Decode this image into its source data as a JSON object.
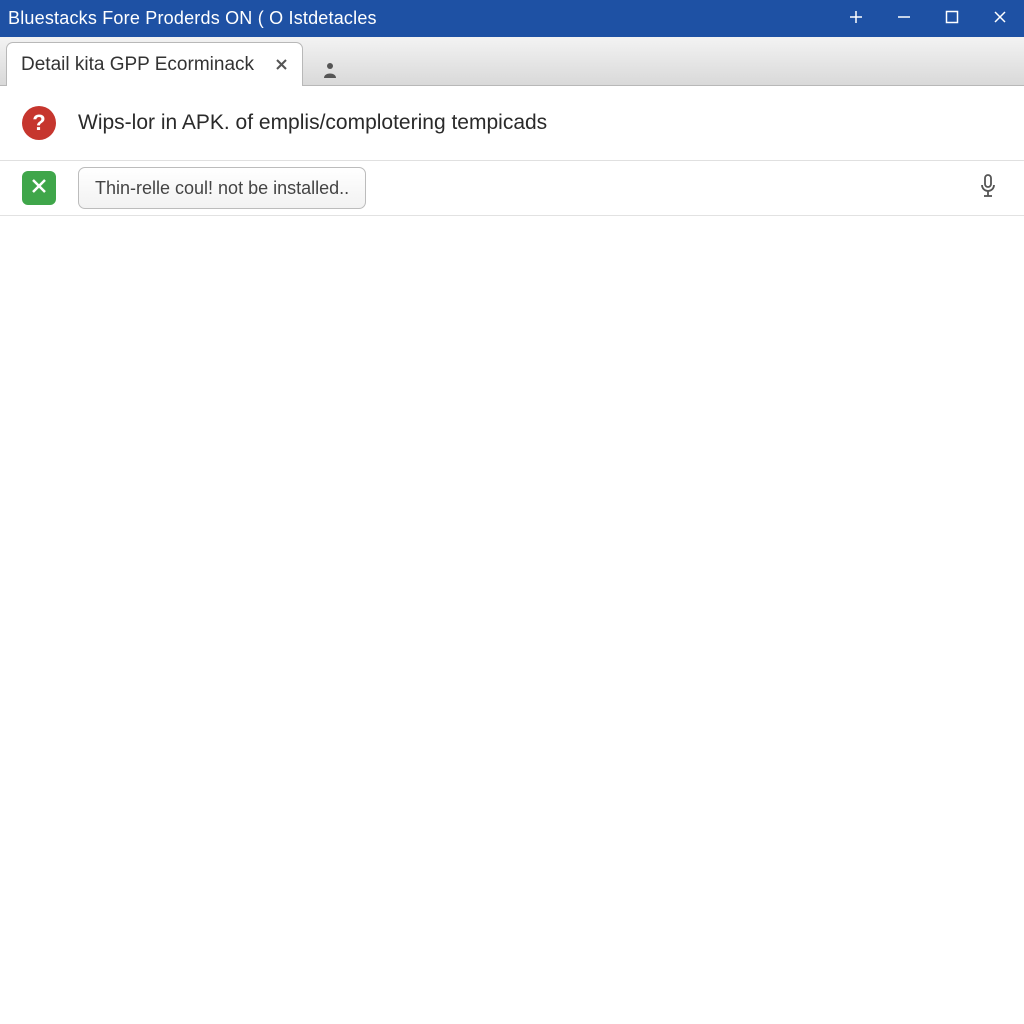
{
  "window": {
    "title": "Bluestacks Fore Proderds ON ( O Istdetacles"
  },
  "tab": {
    "title": "Detail kita GPP Ecorminack"
  },
  "header": {
    "question_glyph": "?",
    "text": "Wips-lor in APK. of emplis/complotering tempicads"
  },
  "status": {
    "message": "Thin-relle coul! not be installed.."
  },
  "icons": {
    "plus": "plus-icon",
    "minimize": "minimize-icon",
    "maximize": "maximize-icon",
    "close": "close-icon",
    "tab_close": "close-icon",
    "user": "user-icon",
    "question": "question-icon",
    "x_badge": "x-badge-icon",
    "mic": "mic-icon"
  }
}
